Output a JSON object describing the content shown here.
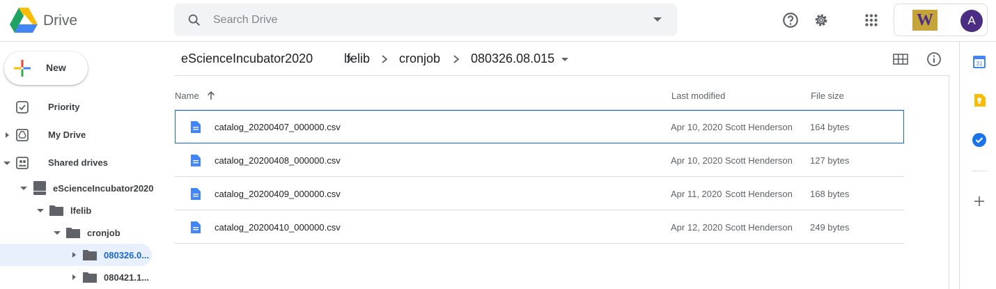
{
  "header": {
    "app_title": "Drive",
    "search_placeholder": "Search Drive",
    "account_initial": "A",
    "org_logo_letter": "W"
  },
  "sidebar": {
    "new_label": "New",
    "nav": [
      {
        "label": "Priority",
        "icon": "checkbox-icon"
      },
      {
        "label": "My Drive",
        "icon": "my-drive-icon"
      },
      {
        "label": "Shared drives",
        "icon": "shared-drives-icon"
      }
    ],
    "tree": [
      {
        "label": "eScienceIncubator2020",
        "icon": "drive-icon",
        "expanded": true
      },
      {
        "label": "lfelib",
        "icon": "folder-icon",
        "expanded": true
      },
      {
        "label": "cronjob",
        "icon": "folder-icon",
        "expanded": true
      },
      {
        "label": "080326.0...",
        "icon": "folder-icon",
        "expanded": false,
        "selected": true
      },
      {
        "label": "080421.1...",
        "icon": "folder-icon",
        "expanded": false
      }
    ]
  },
  "breadcrumb": [
    "eScienceIncubator2020",
    "lfelib",
    "cronjob",
    "080326.08.015"
  ],
  "table": {
    "columns": {
      "name": "Name",
      "modified": "Last modified",
      "size": "File size"
    },
    "rows": [
      {
        "name": "catalog_20200407_000000.csv",
        "date": "Apr 10, 2020",
        "owner": "Scott Henderson",
        "size": "164 bytes",
        "selected": true
      },
      {
        "name": "catalog_20200408_000000.csv",
        "date": "Apr 10, 2020",
        "owner": "Scott Henderson",
        "size": "127 bytes"
      },
      {
        "name": "catalog_20200409_000000.csv",
        "date": "Apr 11, 2020",
        "owner": "Scott Henderson",
        "size": "168 bytes"
      },
      {
        "name": "catalog_20200410_000000.csv",
        "date": "Apr 12, 2020",
        "owner": "Scott Henderson",
        "size": "249 bytes"
      }
    ]
  },
  "side_panel": {
    "calendar_day": "31",
    "icons": [
      "calendar-icon",
      "keep-icon",
      "tasks-icon",
      "add-icon"
    ]
  },
  "colors": {
    "accent": "#1967d2",
    "doc_icon": "#4285f4",
    "selection_bg": "#e8f0fe"
  }
}
